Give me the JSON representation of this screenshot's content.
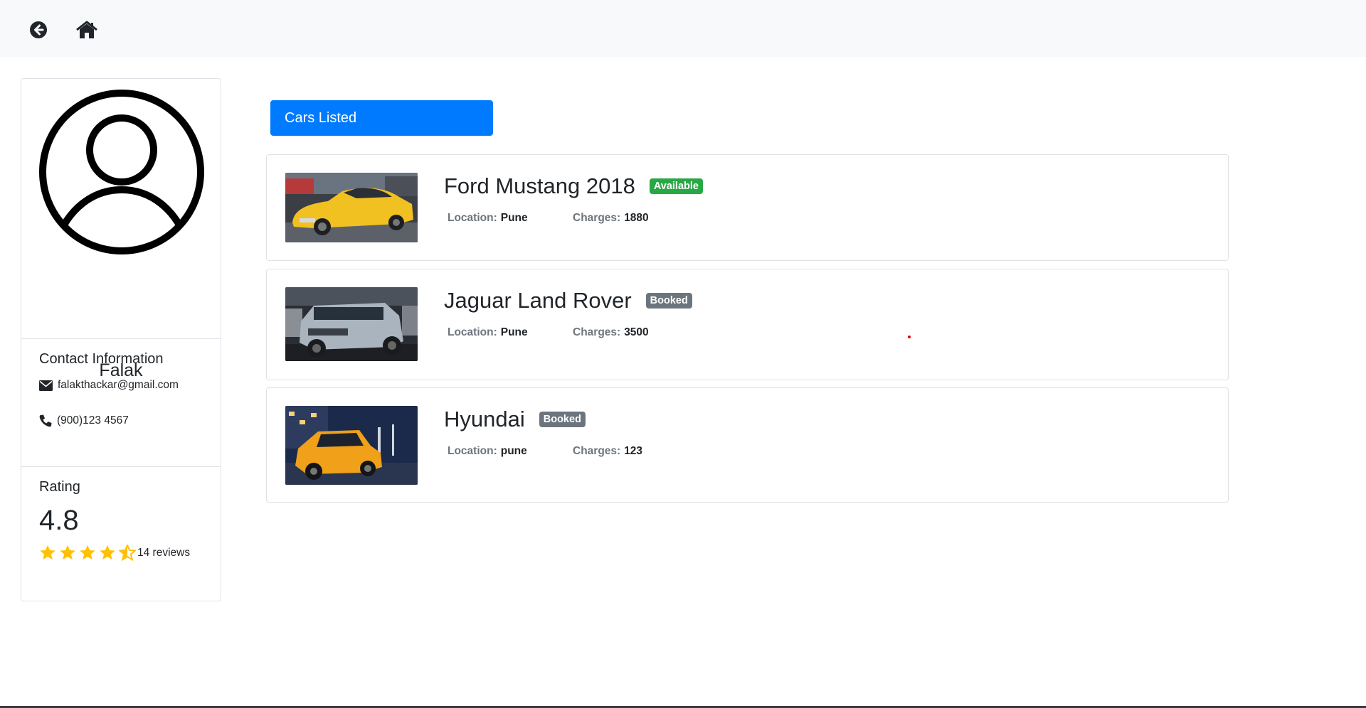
{
  "profile": {
    "name": "Falak",
    "contact_title": "Contact Information",
    "email": "falakthackar@gmail.com",
    "phone": "(900)123 4567",
    "rating_title": "Rating",
    "rating": "4.8",
    "rating_stars": 4.5,
    "reviews": "14 reviews"
  },
  "cars_listed_label": "Cars Listed",
  "labels": {
    "location": "Location:",
    "charges": "Charges:"
  },
  "cars": [
    {
      "name": "Ford Mustang 2018",
      "status": "Available",
      "location": "Pune",
      "charges": "1880",
      "image": "yellow-mustang"
    },
    {
      "name": "Jaguar Land Rover",
      "status": "Booked",
      "location": "Pune",
      "charges": "3500",
      "image": "silver-defender"
    },
    {
      "name": "Hyundai",
      "status": "Booked",
      "location": "pune",
      "charges": "123",
      "image": "orange-hatchback"
    }
  ],
  "colors": {
    "primary": "#007bff",
    "success": "#28a745",
    "secondary": "#6c757d",
    "star": "#ffc107"
  }
}
